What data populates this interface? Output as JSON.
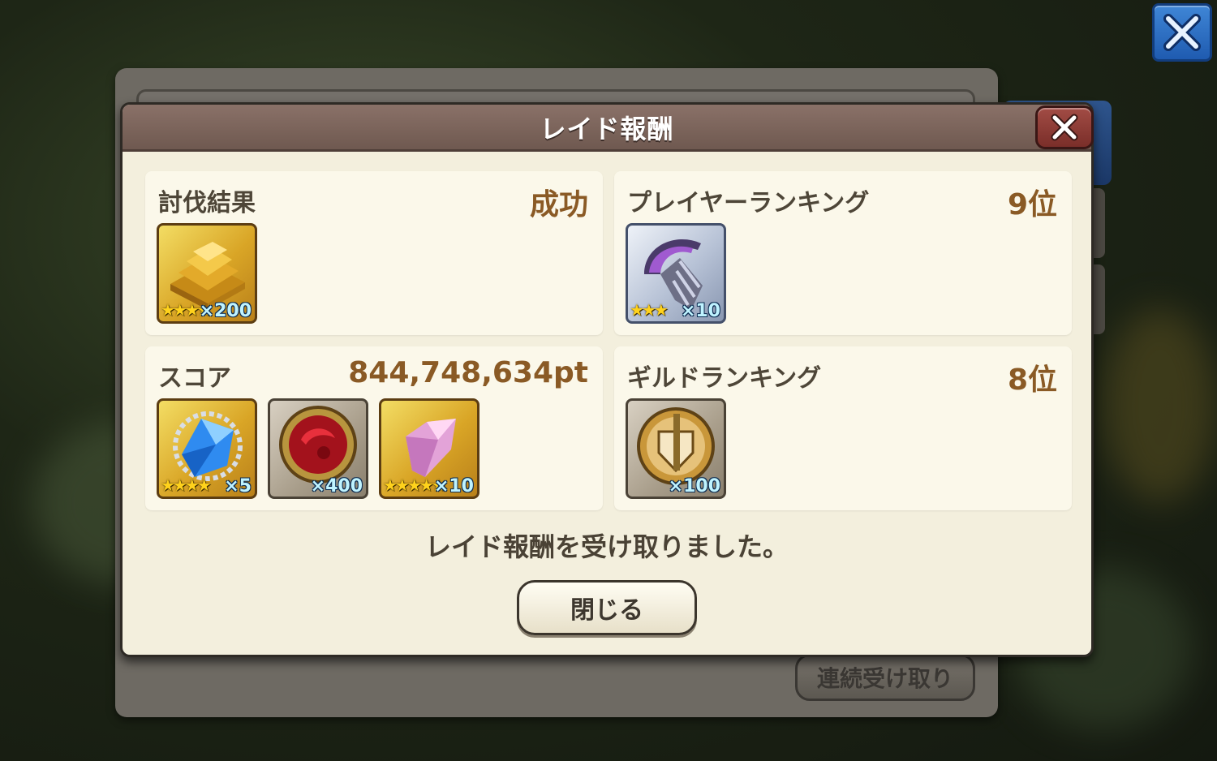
{
  "dialog": {
    "title": "レイド報酬",
    "message": "レイド報酬を受け取りました。",
    "close_label": "閉じる"
  },
  "background": {
    "bulk_receive_label": "連続受け取り"
  },
  "cards": [
    {
      "label": "討伐結果",
      "value": "成功",
      "items": [
        {
          "icon": "gold-bars-icon",
          "stars": "★★★★",
          "count": "×200"
        }
      ]
    },
    {
      "label": "プレイヤーランキング",
      "value": "9位",
      "items": [
        {
          "icon": "dark-claw-weapon-icon",
          "stars": "★★★",
          "count": "×10"
        }
      ]
    },
    {
      "label": "スコア",
      "value": "844,748,634pt",
      "items": [
        {
          "icon": "blue-crystal-icon",
          "stars": "★★★★",
          "count": "×5"
        },
        {
          "icon": "red-orb-medal-icon",
          "stars": "",
          "count": "×400"
        },
        {
          "icon": "pink-crystal-shard-icon",
          "stars": "★★★★★",
          "count": "×10"
        }
      ]
    },
    {
      "label": "ギルドランキング",
      "value": "8位",
      "items": [
        {
          "icon": "guild-shield-medal-icon",
          "stars": "",
          "count": "×100"
        }
      ]
    }
  ],
  "colors": {
    "header": "#7a6259",
    "panel": "#f3efdd",
    "value_text": "#8a5a25",
    "close_red": "#8f3c36",
    "top_close_blue": "#2b6cc0"
  }
}
